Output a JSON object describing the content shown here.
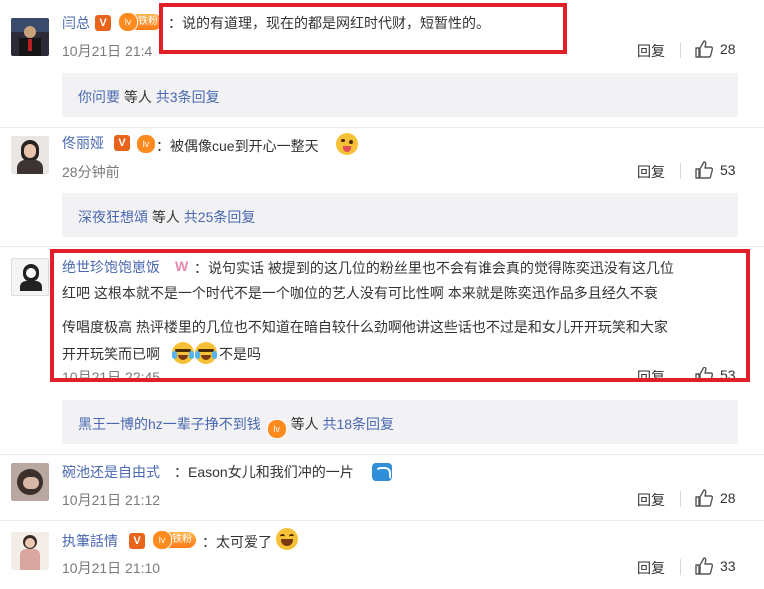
{
  "comments": [
    {
      "user": "闫总",
      "fan_label": "铁粉",
      "text": "：说的有道理，现在的都是网红时代财，短暂性的。",
      "time": "10月21日 21:4",
      "reply": "回复",
      "likes": "28"
    },
    {
      "user": "佟丽娅",
      "text": "：被偶像cue到开心一整天",
      "time": "28分钟前",
      "reply": "回复",
      "likes": "53"
    },
    {
      "user": "绝世珍饱饱崽饭",
      "text_lines": [
        "：说句实话 被提到的这几位的粉丝里也不会有谁会真的觉得陈奕迅没有这几位",
        "红吧 这根本就不是一个时代不是一个咖位的艺人没有可比性啊 本来就是陈奕迅作品多且经久不衰",
        "传唱度极高 热评楼里的几位也不知道在暗自较什么劲啊他讲这些话也不过是和女儿开开玩笑和大家",
        "开开玩笑而已啊",
        "不是吗"
      ],
      "time": "10月21日 22:45",
      "reply": "回复",
      "likes": "53"
    },
    {
      "user": "碗池还是自由式",
      "text": "：Eason女儿和我们冲的一片",
      "time": "10月21日 21:12",
      "reply": "回复",
      "likes": "28"
    },
    {
      "user": "执筆話情",
      "fan_label": "铁粉",
      "text": "：太可爱了",
      "time": "10月21日 21:10",
      "reply": "回复",
      "likes": "33"
    }
  ],
  "reply_bars": [
    {
      "user": "你问要",
      "mid": " 等人 ",
      "count": "共3条回复"
    },
    {
      "user": "深夜狂想頌",
      "mid": " 等人 ",
      "count": "共25条回复"
    },
    {
      "user": "黑王一博的hz一辈子挣不到钱",
      "mid": " 等人 ",
      "count": "共18条回复"
    }
  ],
  "colors": {
    "link": "#4a68b0",
    "highlight_box": "#e21e26",
    "reply_bg": "#f2f2f5"
  }
}
